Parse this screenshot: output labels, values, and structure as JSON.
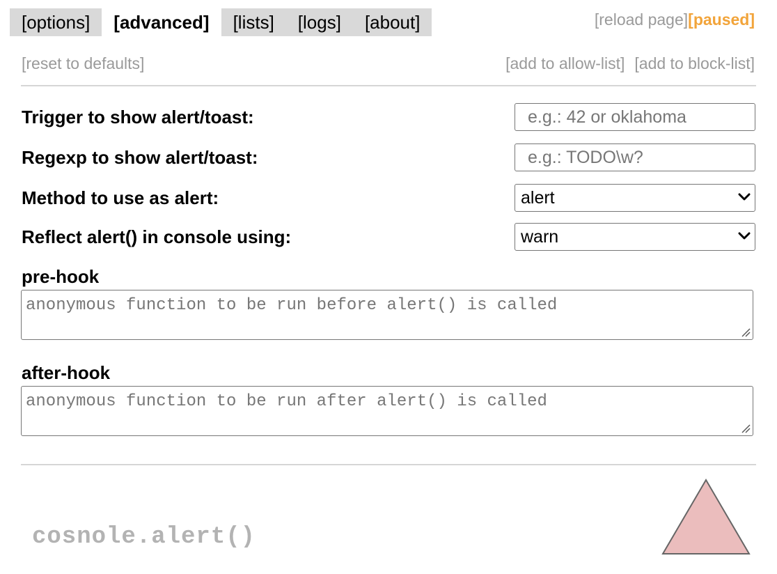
{
  "tabs": [
    {
      "label": "[options]",
      "active": false
    },
    {
      "label": "[advanced]",
      "active": true
    },
    {
      "label": "[lists]",
      "active": false
    },
    {
      "label": "[logs]",
      "active": false
    },
    {
      "label": "[about]",
      "active": false
    }
  ],
  "header": {
    "reload_label": "[reload page]",
    "paused_label": "[paused]"
  },
  "actions": {
    "reset_label": "[reset to defaults]",
    "allow_label": "[add to allow-list]",
    "block_label": "[add to block-list]"
  },
  "settings": {
    "trigger": {
      "label": "Trigger to show alert/toast:",
      "value": "",
      "placeholder": "e.g.: 42 or oklahoma"
    },
    "regexp": {
      "label": "Regexp to show alert/toast:",
      "value": "",
      "placeholder": "e.g.: TODO\\w?"
    },
    "method": {
      "label": "Method to use as alert:",
      "selected": "alert"
    },
    "reflect": {
      "label": "Reflect alert() in console using:",
      "selected": "warn"
    }
  },
  "prehook": {
    "label": "pre-hook",
    "placeholder": "anonymous function to be run before alert() is called"
  },
  "afterhook": {
    "label": "after-hook",
    "placeholder": "anonymous function to be run after alert() is called"
  },
  "footer": {
    "brand": "cosnole.alert()"
  },
  "colors": {
    "paused": "#f2a43a",
    "muted": "#9a9a9a",
    "tab_bg": "#d9d9d9",
    "logo_fill": "#ebbdbd",
    "logo_stroke": "#666666"
  },
  "icons": {
    "select_arrow": "chevron-down-icon",
    "resize": "resize-grip-icon",
    "logo": "triangle-logo-icon"
  }
}
